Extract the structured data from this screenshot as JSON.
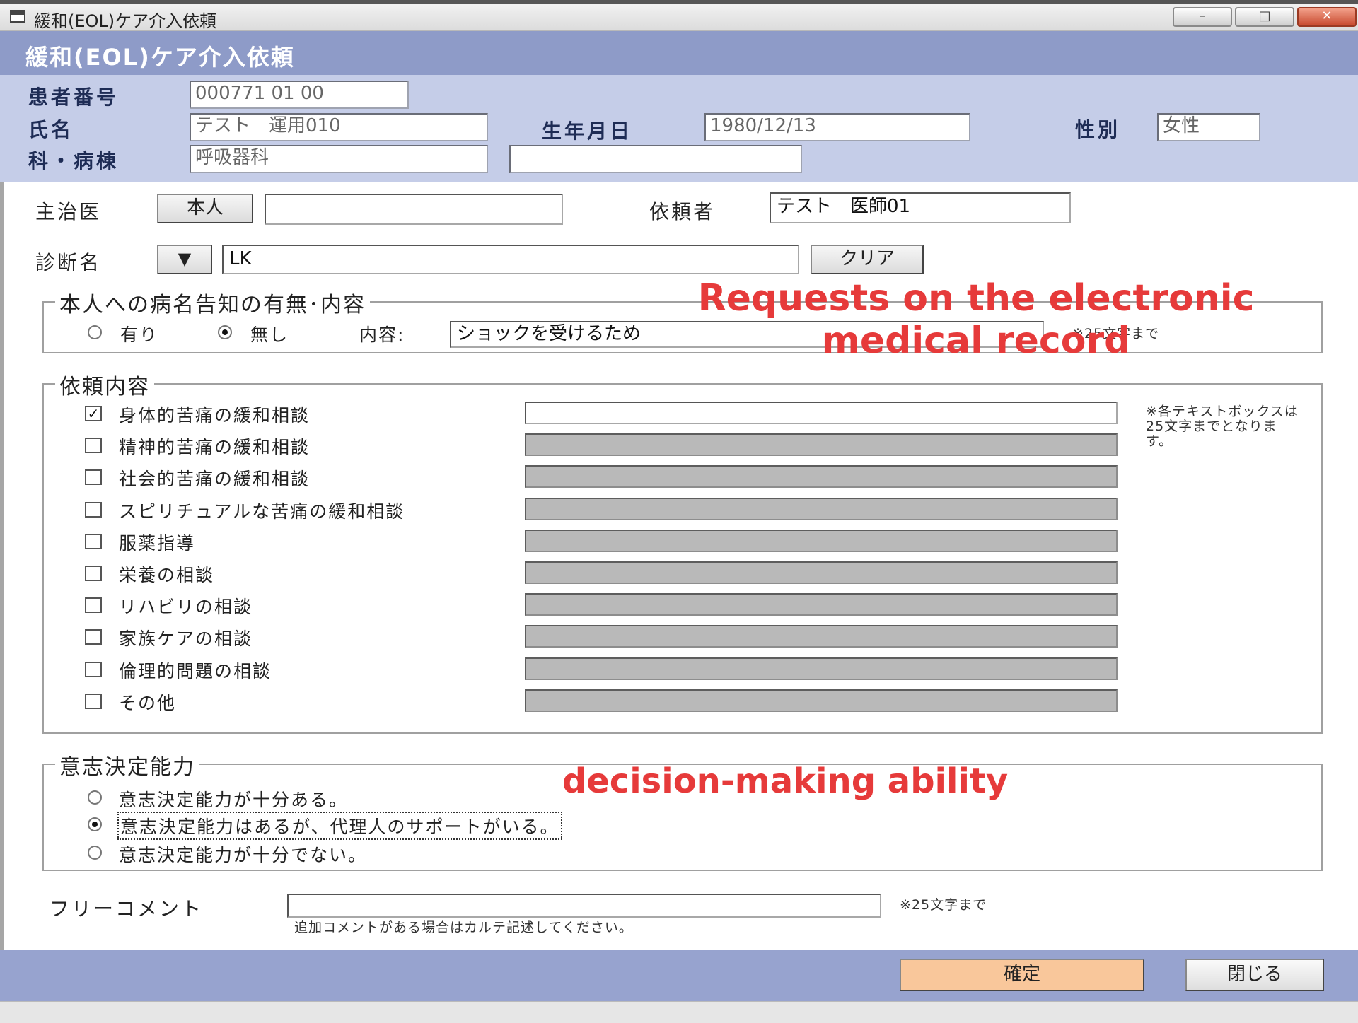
{
  "window": {
    "title": "緩和(EOL)ケア介入依頼",
    "minimize": "–",
    "maximize": "□",
    "close": "✕"
  },
  "header": {
    "title": "緩和(EOL)ケア介入依頼"
  },
  "patient": {
    "id_label": "患者番号",
    "id_value": "000771 01 00",
    "name_label": "氏名",
    "name_value": "テスト　運用010",
    "dob_label": "生年月日",
    "dob_value": "1980/12/13",
    "sex_label": "性別",
    "sex_value": "女性",
    "dept_label": "科・病棟",
    "dept_value": "呼吸器科",
    "ward_value": ""
  },
  "attending": {
    "label": "主治医",
    "self_button": "本人",
    "value": ""
  },
  "requester": {
    "label": "依頼者",
    "value": "テスト　医師01"
  },
  "diagnosis": {
    "label": "診断名",
    "dropdown_icon": "▼",
    "value": "LK",
    "clear_button": "クリア"
  },
  "disclosure": {
    "title": "本人への病名告知の有無･内容",
    "opt_yes": "有り",
    "opt_no": "無し",
    "selected": "無し",
    "content_label": "内容:",
    "content_value": "ショックを受けるため",
    "note": "※25文字まで"
  },
  "request": {
    "title": "依頼内容",
    "note": "※各テキストボックスは25文字までとなります。",
    "items": [
      {
        "label": "身体的苦痛の緩和相談",
        "checked": true
      },
      {
        "label": "精神的苦痛の緩和相談",
        "checked": false
      },
      {
        "label": "社会的苦痛の緩和相談",
        "checked": false
      },
      {
        "label": "スピリチュアルな苦痛の緩和相談",
        "checked": false
      },
      {
        "label": "服薬指導",
        "checked": false
      },
      {
        "label": "栄養の相談",
        "checked": false
      },
      {
        "label": "リハビリの相談",
        "checked": false
      },
      {
        "label": "家族ケアの相談",
        "checked": false
      },
      {
        "label": "倫理的問題の相談",
        "checked": false
      },
      {
        "label": "その他",
        "checked": false
      }
    ]
  },
  "decision": {
    "title": "意志決定能力",
    "options": [
      "意志決定能力が十分ある。",
      "意志決定能力はあるが、代理人のサポートがいる。",
      "意志決定能力が十分でない。"
    ],
    "selected_index": 1
  },
  "comment": {
    "label": "フリーコメント",
    "value": "",
    "note": "※25文字まで",
    "hint": "追加コメントがある場合はカルテ記述してください。"
  },
  "footer": {
    "confirm_button": "確定",
    "close_button": "閉じる"
  },
  "annotations": {
    "emr_line1": "Requests on the electronic",
    "emr_line2": "medical record",
    "decision": "decision-making ability"
  },
  "colors": {
    "header_band": "#8e9bc8",
    "info_band": "#c5cde8",
    "confirm_button": "#f9c79b",
    "annotation": "#e63a3a"
  }
}
